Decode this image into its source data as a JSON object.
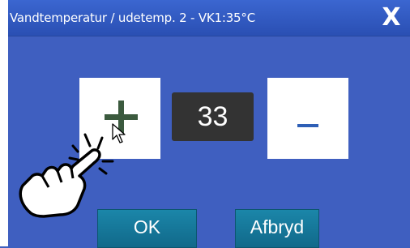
{
  "dialog": {
    "title": "Vandtemperatur / udetemp. 2 - VK1:35°C",
    "close_label": "X"
  },
  "stepper": {
    "value": "33",
    "increment_icon": "plus-icon",
    "decrement_icon": "minus-icon"
  },
  "buttons": {
    "ok_label": "OK",
    "cancel_label": "Afbryd"
  },
  "colors": {
    "background": "#3f5fc0",
    "titlebar": "#2f56b8",
    "button": "#177a9c",
    "value_box": "#333333"
  },
  "overlay": {
    "pointer_icon": "pointing-hand-icon",
    "cursor_icon": "mouse-cursor-icon"
  }
}
